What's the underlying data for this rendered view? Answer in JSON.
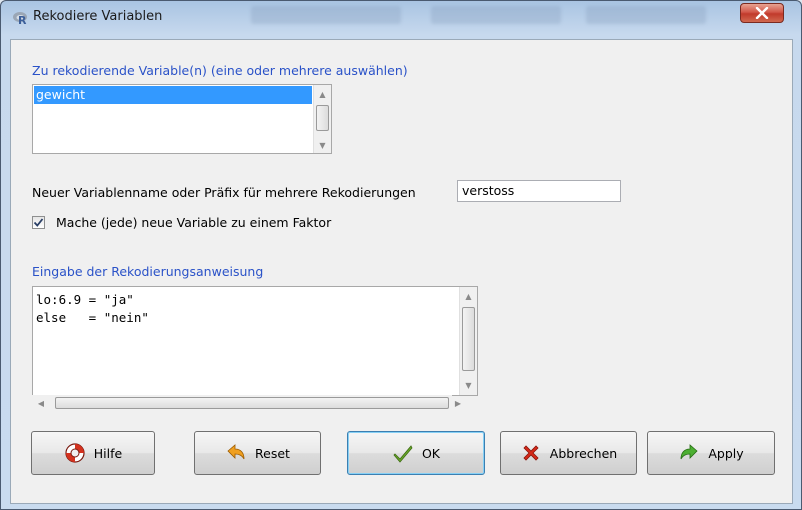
{
  "window": {
    "title": "Rekodiere Variablen",
    "close_label": "x"
  },
  "variables": {
    "label": "Zu rekodierende Variable(n) (eine oder mehrere auswählen)",
    "items": [
      "gewicht"
    ],
    "selected": "gewicht"
  },
  "new_name": {
    "label": "Neuer Variablenname oder Präfix für mehrere Rekodierungen",
    "value": "verstoss"
  },
  "factor_checkbox": {
    "label": "Mache (jede) neue Variable zu einem Faktor",
    "checked": true
  },
  "recode": {
    "label": "Eingabe der Rekodierungsanweisung",
    "lines": [
      "lo:6.9 = \"ja\"",
      "else   = \"nein\""
    ]
  },
  "buttons": {
    "help": "Hilfe",
    "reset": "Reset",
    "ok": "OK",
    "cancel": "Abbrechen",
    "apply": "Apply"
  },
  "icons": {
    "window": "r-logo-icon",
    "help": "lifebuoy-icon",
    "reset": "undo-arrow-icon",
    "ok": "checkmark-icon",
    "cancel": "red-x-icon",
    "apply": "green-redo-arrow-icon"
  },
  "colors": {
    "section_label": "#2a52c8",
    "selection": "#3399ff",
    "close_button": "#c13a2b"
  }
}
